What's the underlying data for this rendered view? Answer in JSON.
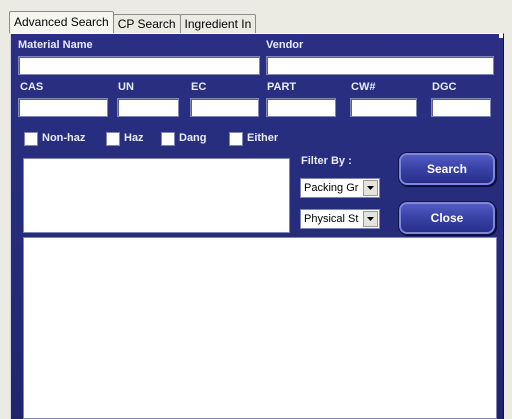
{
  "tabs": [
    "Advanced Search",
    "CP Search",
    "Ingredient In"
  ],
  "labels": {
    "material_name": "Material Name",
    "vendor": "Vendor",
    "cas": "CAS",
    "un": "UN",
    "ec": "EC",
    "part": "PART",
    "cw": "CW#",
    "dgc": "DGC",
    "filter_by": "Filter By :"
  },
  "checkboxes": [
    "Non-haz",
    "Haz",
    "Dang",
    "Either"
  ],
  "filters": {
    "packing": "Packing Gr",
    "physical": "Physical St"
  },
  "buttons": {
    "search": "Search",
    "close": "Close"
  }
}
